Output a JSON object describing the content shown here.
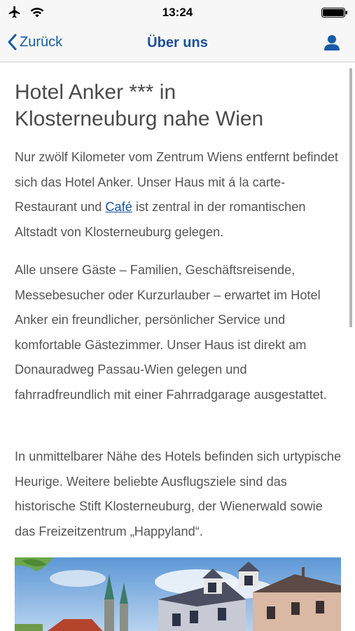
{
  "status": {
    "time": "13:24"
  },
  "nav": {
    "back_label": "Zurück",
    "title": "Über uns"
  },
  "content": {
    "title": "Hotel Anker *** in Klosterneuburg nahe Wien",
    "para1_before": "Nur zwölf Kilometer vom Zentrum Wiens entfernt befindet sich das Hotel Anker. Unser Haus mit á la carte-Restaurant und ",
    "para1_link": "Café",
    "para1_after": " ist zentral in der romantischen Altstadt von Klosterneuburg gelegen.",
    "para2": "Alle unsere Gäste – Familien, Geschäftsreisende, Messebesucher oder Kurzurlauber – erwartet im Hotel Anker ein freundlicher, persönlicher Service und komfortable Gästezimmer. Unser Haus ist direkt am Donauradweg Passau-Wien gelegen und fahrradfreundlich mit einer Fahrradgarage ausgestattet.",
    "para3": "In unmittelbarer Nähe des Hotels befinden sich urtypische Heurige. Weitere beliebte Ausflugsziele sind das historische Stift Klosterneuburg, der Wienerwald sowie das Freizeitzentrum „Happyland“."
  },
  "colors": {
    "accent": "#1a5ba8",
    "title_blue": "#1a4f9c",
    "text": "#555555"
  },
  "icons": [
    "airplane-icon",
    "wifi-icon",
    "battery-icon",
    "chevron-left-icon",
    "user-icon"
  ]
}
